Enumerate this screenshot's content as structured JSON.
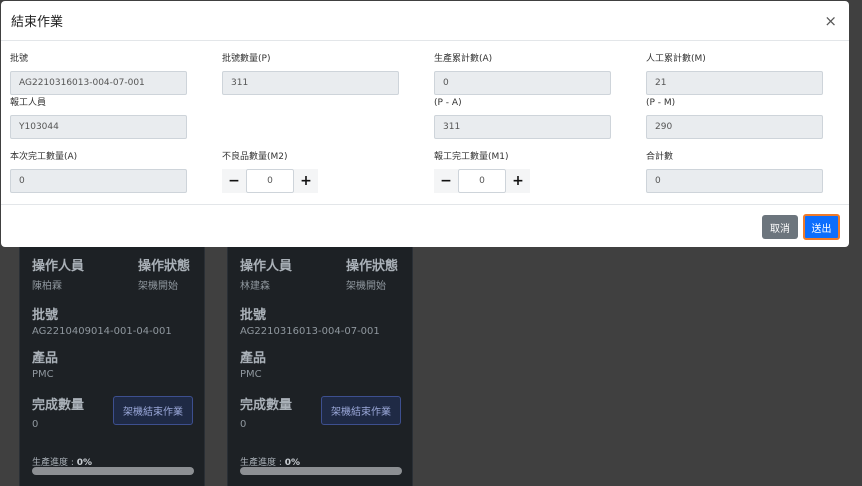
{
  "modal": {
    "title": "結束作業",
    "close_icon": "×",
    "fields": {
      "batch_no": {
        "label": "批號",
        "value": "AG2210316013-004-07-001"
      },
      "batch_qty": {
        "label": "批號數量(P)",
        "value": "311"
      },
      "prod_total": {
        "label": "生產累計數(A)",
        "value": "0"
      },
      "manual_total": {
        "label": "人工累計數(M)",
        "value": "21"
      },
      "reporter": {
        "label": "報工人員",
        "value": "Y103044"
      },
      "p_minus_a": {
        "label": "(P - A)",
        "value": "311"
      },
      "p_minus_m": {
        "label": "(P - M)",
        "value": "290"
      },
      "this_qty": {
        "label": "本次完工數量(A)",
        "value": "0"
      },
      "defect_qty": {
        "label": "不良品數量(M2)",
        "value": "0"
      },
      "report_qty": {
        "label": "報工完工數量(M1)",
        "value": "0"
      },
      "total": {
        "label": "合計數",
        "value": "0"
      }
    },
    "stepper": {
      "minus": "−",
      "plus": "+"
    },
    "cancel_label": "取消",
    "submit_label": "送出"
  },
  "cards": [
    {
      "operator_label": "操作人員",
      "operator": "陳柏霖",
      "status_label": "操作狀態",
      "status": "架機開始",
      "batch_label": "批號",
      "batch": "AG2210409014-001-04-001",
      "product_label": "產品",
      "product": "PMC",
      "done_label": "完成數量",
      "done": "0",
      "end_button": "架機結束作業",
      "progress_label": "生產進度 : ",
      "progress_value": "0%",
      "progress_fraction": 0.0
    },
    {
      "operator_label": "操作人員",
      "operator": "林建森",
      "status_label": "操作狀態",
      "status": "架機開始",
      "batch_label": "批號",
      "batch": "AG2210316013-004-07-001",
      "product_label": "產品",
      "product": "PMC",
      "done_label": "完成數量",
      "done": "0",
      "end_button": "架機結束作業",
      "progress_label": "生產進度 : ",
      "progress_value": "0%",
      "progress_fraction": 0.0
    }
  ]
}
